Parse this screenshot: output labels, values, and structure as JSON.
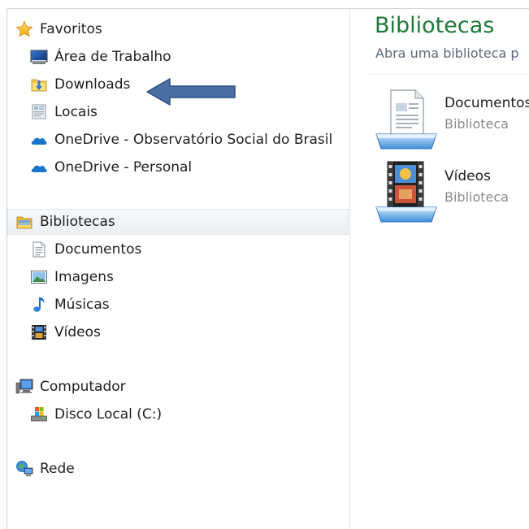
{
  "nav": {
    "favorites": {
      "label": "Favoritos",
      "items": [
        {
          "label": "Área de Trabalho",
          "icon": "desktop-icon"
        },
        {
          "label": "Downloads",
          "icon": "downloads-folder-icon"
        },
        {
          "label": "Locais",
          "icon": "recent-places-icon"
        },
        {
          "label": "OneDrive - Observatório Social do Brasil",
          "icon": "onedrive-icon"
        },
        {
          "label": "OneDrive - Personal",
          "icon": "onedrive-icon"
        }
      ]
    },
    "libraries": {
      "label": "Bibliotecas",
      "selected": true,
      "items": [
        {
          "label": "Documentos",
          "icon": "documents-icon"
        },
        {
          "label": "Imagens",
          "icon": "pictures-icon"
        },
        {
          "label": "Músicas",
          "icon": "music-icon"
        },
        {
          "label": "Vídeos",
          "icon": "videos-icon"
        }
      ]
    },
    "computer": {
      "label": "Computador",
      "items": [
        {
          "label": "Disco Local (C:)",
          "icon": "local-disk-icon"
        }
      ]
    },
    "network": {
      "label": "Rede"
    }
  },
  "content": {
    "title": "Bibliotecas",
    "subtitle": "Abra uma biblioteca p",
    "items": [
      {
        "name": "Documentos",
        "type": "Biblioteca",
        "icon": "documents-library-icon"
      },
      {
        "name": "Vídeos",
        "type": "Biblioteca",
        "icon": "videos-library-icon"
      }
    ]
  },
  "annotation": {
    "arrow_color": "#4a6fa5",
    "points_to": "Downloads"
  }
}
